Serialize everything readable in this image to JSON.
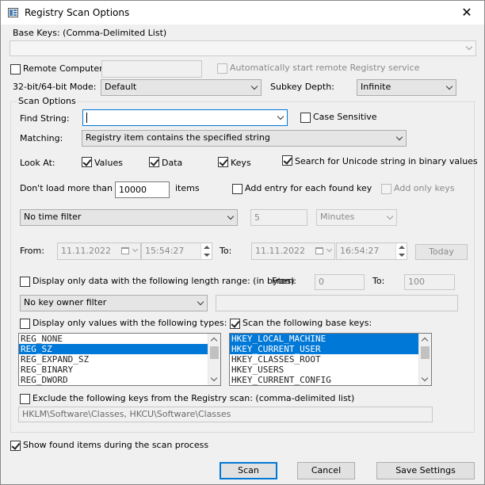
{
  "window": {
    "title": "Registry Scan Options"
  },
  "base_keys": {
    "label": "Base Keys:  (Comma-Delimited List)",
    "value": ""
  },
  "remote": {
    "checkbox_label": "Remote Computer:",
    "computer_value": "",
    "auto_start_label": "Automatically start remote Registry service"
  },
  "mode": {
    "label": "32-bit/64-bit Mode:",
    "value": "Default"
  },
  "subkey_depth": {
    "label": "Subkey Depth:",
    "value": "Infinite"
  },
  "scan_options": {
    "title": "Scan Options",
    "find_string": {
      "label": "Find String:",
      "value": ""
    },
    "case_sensitive_label": "Case Sensitive",
    "matching": {
      "label": "Matching:",
      "value": "Registry item contains the specified string"
    },
    "look_at": {
      "label": "Look At:",
      "values_label": "Values",
      "data_label": "Data",
      "keys_label": "Keys",
      "unicode_label": "Search for Unicode string in binary values"
    },
    "limit": {
      "label": "Don't load more than",
      "value": "10000",
      "unit_label": "items",
      "add_entry_label": "Add entry for each found key",
      "add_only_keys_label": "Add only keys"
    },
    "time_filter": {
      "value": "No time filter",
      "amount": "5",
      "unit": "Minutes"
    },
    "date_range": {
      "from_label": "From:",
      "from_date": "11.11.2022",
      "from_time": "15:54:27",
      "to_label": "To:",
      "to_date": "11.11.2022",
      "to_time": "16:54:27",
      "today_label": "Today"
    },
    "length_range": {
      "label": "Display only data with the following length range: (in bytes)",
      "from_label": "From:",
      "from_value": "0",
      "to_label": "To:",
      "to_value": "100"
    },
    "owner_filter": {
      "value": "No key owner filter",
      "text": ""
    },
    "value_types": {
      "label": "Display only values with the following types:",
      "items": [
        "REG_NONE",
        "REG_SZ",
        "REG_EXPAND_SZ",
        "REG_BINARY",
        "REG_DWORD"
      ],
      "selected_index": 1
    },
    "base_keys_scan": {
      "label": "Scan the following base keys:",
      "items": [
        "HKEY_LOCAL_MACHINE",
        "HKEY_CURRENT_USER",
        "HKEY_CLASSES_ROOT",
        "HKEY_USERS",
        "HKEY_CURRENT_CONFIG"
      ],
      "selected": [
        0,
        1
      ]
    },
    "exclude": {
      "label": "Exclude the following keys from the Registry scan: (comma-delimited list)",
      "value": "HKLM\\Software\\Classes, HKCU\\Software\\Classes"
    }
  },
  "show_found_label": "Show found items during the scan process",
  "buttons": {
    "scan": "Scan",
    "cancel": "Cancel",
    "save": "Save Settings"
  }
}
